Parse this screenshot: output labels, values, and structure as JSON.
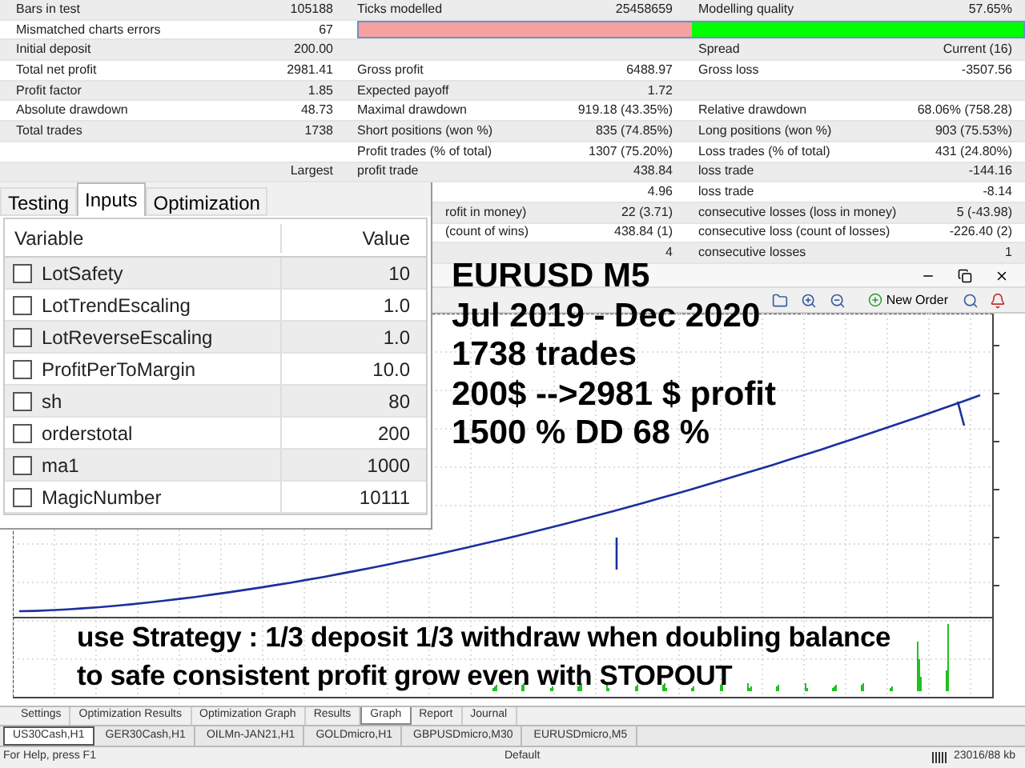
{
  "report": {
    "rows": [
      {
        "kind": "full",
        "col1": {
          "label": "Bars in test",
          "value": "105188"
        },
        "col2": {
          "label": "Ticks modelled",
          "value": "25458659"
        },
        "col3": {
          "label": "Modelling quality",
          "value": "57.65%"
        }
      },
      {
        "kind": "bar",
        "col1": {
          "label": "Mismatched charts errors",
          "value": "67"
        },
        "level": 0.5
      },
      {
        "kind": "full",
        "col1": {
          "label": "Initial deposit",
          "value": "200.00"
        },
        "col3": {
          "label": "Spread",
          "value": "Current (16)"
        }
      },
      {
        "kind": "full",
        "col1": {
          "label": "Total net profit",
          "value": "2981.41"
        },
        "col2": {
          "label": "Gross profit",
          "value": "6488.97"
        },
        "col3": {
          "label": "Gross loss",
          "value": "-3507.56"
        }
      },
      {
        "kind": "full",
        "col1": {
          "label": "Profit factor",
          "value": "1.85"
        },
        "col2": {
          "label": "Expected payoff",
          "value": "1.72"
        }
      },
      {
        "kind": "full",
        "col1": {
          "label": "Absolute drawdown",
          "value": "48.73"
        },
        "col2": {
          "label": "Maximal drawdown",
          "value": "919.18 (43.35%)"
        },
        "col3": {
          "label": "Relative drawdown",
          "value": "68.06% (758.28)"
        }
      },
      {
        "kind": "full",
        "col1": {
          "label": "Total trades",
          "value": "1738"
        },
        "col2": {
          "label": "Short positions (won %)",
          "value": "835 (74.85%)"
        },
        "col3": {
          "label": "Long positions (won %)",
          "value": "903 (75.53%)"
        }
      },
      {
        "kind": "full",
        "col2": {
          "label": "Profit trades (% of total)",
          "value": "1307 (75.20%)"
        },
        "col3": {
          "label": "Loss trades (% of total)",
          "value": "431 (24.80%)"
        }
      },
      {
        "kind": "full",
        "col1": {
          "value": "Largest"
        },
        "col2": {
          "label": "profit trade",
          "value": "438.84"
        },
        "col3": {
          "label": "loss trade",
          "value": "-144.16"
        }
      },
      {
        "kind": "partial",
        "col2": {
          "value": "4.96"
        },
        "col3": {
          "label": "loss trade",
          "value": "-8.14"
        }
      },
      {
        "kind": "partial",
        "col2": {
          "label": "rofit in money)",
          "value": "22 (3.71)"
        },
        "col3": {
          "label": "consecutive losses (loss in money)",
          "value": "5 (-43.98)"
        }
      },
      {
        "kind": "partial",
        "col2": {
          "label": "(count of wins)",
          "value": "438.84 (1)"
        },
        "col3": {
          "label": "consecutive loss (count of losses)",
          "value": "-226.40 (2)"
        }
      },
      {
        "kind": "partial",
        "col2": {
          "value": "4"
        },
        "col3": {
          "label": "consecutive losses",
          "value": "1"
        }
      }
    ]
  },
  "inputs_panel": {
    "tabs": [
      {
        "label": "Testing",
        "selected": false
      },
      {
        "label": "Inputs",
        "selected": true
      },
      {
        "label": "Optimization",
        "selected": false
      }
    ],
    "columns": [
      "Variable",
      "Value"
    ],
    "rows": [
      {
        "name": "LotSafety",
        "value": "10",
        "checked": false
      },
      {
        "name": "LotTrendEscaling",
        "value": "1.0",
        "checked": false
      },
      {
        "name": "LotReverseEscaling",
        "value": "1.0",
        "checked": false
      },
      {
        "name": "ProfitPerToMargin",
        "value": "10.0",
        "checked": false
      },
      {
        "name": "sh",
        "value": "80",
        "checked": false
      },
      {
        "name": "orderstotal",
        "value": "200",
        "checked": false
      },
      {
        "name": "ma1",
        "value": "1000",
        "checked": false
      },
      {
        "name": "MagicNumber",
        "value": "10111",
        "checked": false
      }
    ]
  },
  "chart_window": {
    "toolbar": {
      "new_order": "New Order"
    }
  },
  "overlay_lines": [
    "EURUSD M5",
    "Jul 2019 - Dec 2020",
    "1738 trades",
    "200$ -->2981 $ profit",
    "1500 % DD 68 %"
  ],
  "footer_lines": [
    "use Strategy : 1/3 deposit 1/3 withdraw when doubling balance",
    "to safe consistent profit grow even with STOPOUT"
  ],
  "tester_tabs": [
    {
      "label": "Settings",
      "selected": false
    },
    {
      "label": "Optimization Results",
      "selected": false
    },
    {
      "label": "Optimization Graph",
      "selected": false
    },
    {
      "label": "Results",
      "selected": false
    },
    {
      "label": "Graph",
      "selected": true
    },
    {
      "label": "Report",
      "selected": false
    },
    {
      "label": "Journal",
      "selected": false
    }
  ],
  "chart_tabs": [
    {
      "label": "US30Cash,H1",
      "selected": true
    },
    {
      "label": "GER30Cash,H1",
      "selected": false
    },
    {
      "label": "OILMn-JAN21,H1",
      "selected": false
    },
    {
      "label": "GOLDmicro,H1",
      "selected": false
    },
    {
      "label": "GBPUSDmicro,M30",
      "selected": false
    },
    {
      "label": "EURUSDmicro,M5",
      "selected": false
    }
  ],
  "status_bar": {
    "help": "For Help, press F1",
    "profile": "Default",
    "traffic": "23016/88 kb"
  }
}
